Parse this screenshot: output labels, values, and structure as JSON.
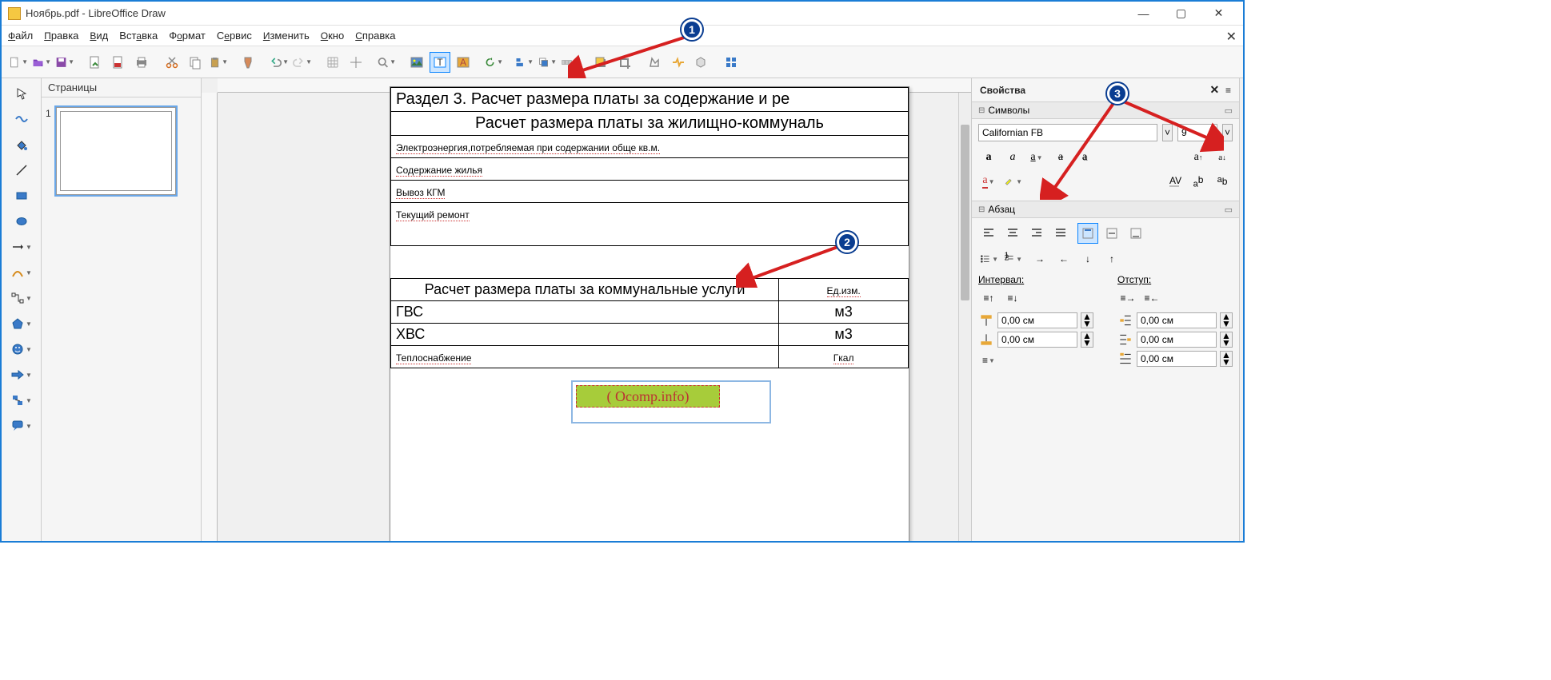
{
  "title": "Ноябрь.pdf - LibreOffice Draw",
  "menu": {
    "file": "Файл",
    "edit": "Правка",
    "view": "Вид",
    "insert": "Вставка",
    "format": "Формат",
    "tools": "Сервис",
    "modify": "Изменить",
    "window": "Окно",
    "help": "Справка"
  },
  "panels": {
    "pages": "Страницы",
    "properties": "Свойства",
    "symbols": "Символы",
    "paragraph": "Абзац"
  },
  "font": {
    "name": "Californian FB",
    "size": "9"
  },
  "para": {
    "spacing_label": "Интервал:",
    "indent_label": "Отступ:",
    "sp1": "0,00 см",
    "sp2": "0,00 см",
    "in1": "0,00 см",
    "in2": "0,00 см",
    "in3": "0,00 см"
  },
  "doc": {
    "h1": "Раздел 3. Расчет размера платы за содержание и ре",
    "h2": "Расчет размера платы за жилищно-коммуналь",
    "r1": "Электроэнергия,потребляемая при содержании обще кв.м.",
    "r2": "Содержание жилья",
    "r3": "Вывоз КГМ",
    "r4": "Текущий ремонт",
    "textfield": "( Ocomp.info)",
    "t2h1": "Расчет размера платы за коммунальные услуги",
    "t2h2": "Ед.изм.",
    "t2r1a": "ГВС",
    "t2r1b": "м3",
    "t2r2a": "ХВС",
    "t2r2b": "м3",
    "t2r3a": "Теплоснабжение",
    "t2r3b": "Гкал"
  },
  "page_num": "1",
  "annotations": {
    "a1": "1",
    "a2": "2",
    "a3": "3"
  }
}
